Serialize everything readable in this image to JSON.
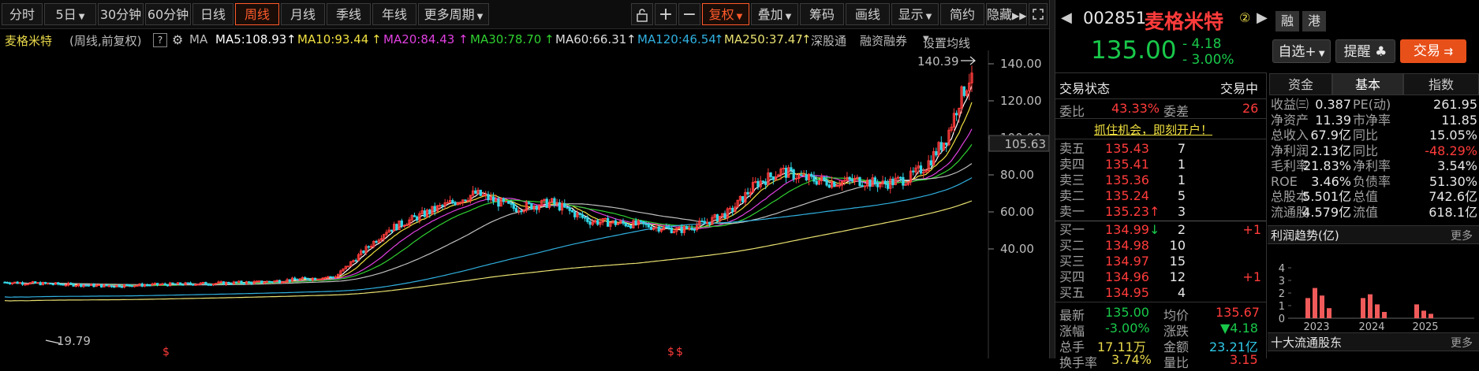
{
  "toolbar": {
    "tabs": [
      "分时",
      "5日",
      "30分钟",
      "60分钟",
      "日线",
      "周线",
      "月线",
      "季线",
      "年线",
      "更多周期"
    ],
    "active_tab": "周线",
    "tools": [
      "复权",
      "叠加",
      "筹码",
      "画线",
      "显示",
      "简约",
      "隐藏"
    ],
    "tools_active": "复权"
  },
  "ma_line": {
    "stock_name": "麦格米特",
    "mode": "(周线,前复权)",
    "help": "?",
    "ma_label": "MA",
    "ma5": "MA5:108.93",
    "ma10": "MA10:93.44",
    "ma20": "MA20:84.43",
    "ma30": "MA30:78.70",
    "ma60": "MA60:66.31",
    "ma120": "MA120:46.54",
    "ma250": "MA250:37.47",
    "link1": "深股通",
    "link2": "融资融券",
    "link3": "设置均线"
  },
  "chart_data": {
    "type": "candlestick",
    "yticks": [
      "140.00",
      "120.00",
      "100.00",
      "80.00",
      "60.00",
      "40.00"
    ],
    "ylim": [
      28,
      148
    ],
    "current_price_tag": "105.63",
    "high_label": "140.39",
    "low_label": "19.79",
    "markers": [
      "$",
      "$",
      "$"
    ],
    "ma_colors": {
      "ma5": "#ffffff",
      "ma10": "#f0e040",
      "ma20": "#e040e0",
      "ma30": "#30d030",
      "ma60": "#c0c0c0",
      "ma120": "#30b0e0",
      "ma250": "#e8e070"
    }
  },
  "quote": {
    "code": "002851",
    "name": "麦格米特",
    "badge": "②",
    "tag1": "融",
    "tag2": "港",
    "price": "135.00",
    "change": "- 4.18",
    "change_pct": "- 3.00%",
    "btn_watch": "自选+",
    "btn_alert": "提醒",
    "btn_trade": "交易"
  },
  "order_book": {
    "status_label": "交易状态",
    "status_value": "交易中",
    "webi_label": "委比",
    "webi_value": "43.33%",
    "weicha_label": "委差",
    "weicha_value": "26",
    "banner": "抓住机会，即刻开户！",
    "sells": [
      {
        "label": "卖五",
        "price": "135.43",
        "vol": "7",
        "mark": ""
      },
      {
        "label": "卖四",
        "price": "135.41",
        "vol": "1",
        "mark": ""
      },
      {
        "label": "卖三",
        "price": "135.36",
        "vol": "1",
        "mark": ""
      },
      {
        "label": "卖二",
        "price": "135.24",
        "vol": "5",
        "mark": ""
      },
      {
        "label": "卖一",
        "price": "135.23",
        "vol": "3",
        "mark": "↑"
      }
    ],
    "buys": [
      {
        "label": "买一",
        "price": "134.99",
        "vol": "2",
        "mark": "↓",
        "delta": "+1"
      },
      {
        "label": "买二",
        "price": "134.98",
        "vol": "10",
        "mark": "",
        "delta": ""
      },
      {
        "label": "买三",
        "price": "134.97",
        "vol": "15",
        "mark": "",
        "delta": ""
      },
      {
        "label": "买四",
        "price": "134.96",
        "vol": "12",
        "mark": "",
        "delta": "+1"
      },
      {
        "label": "买五",
        "price": "134.95",
        "vol": "4",
        "mark": "",
        "delta": ""
      }
    ]
  },
  "stats": {
    "latest_label": "最新",
    "latest": "135.00",
    "avg_label": "均价",
    "avg": "135.67",
    "pct_label": "涨幅",
    "pct": "-3.00%",
    "chg_label": "涨跌",
    "chg": "▼4.18",
    "vol_label": "总手",
    "vol": "17.11万",
    "amt_label": "金额",
    "amt": "23.21亿",
    "turnover_label": "换手率",
    "turnover": "3.74%",
    "ratio_label": "量比",
    "ratio": "3.15"
  },
  "fin_tabs": [
    "资金",
    "基本",
    "指数"
  ],
  "fin_active": "基本",
  "fin": [
    [
      "收益㈢",
      "0.387",
      "PE(动)",
      "261.95"
    ],
    [
      "净资产",
      "11.39",
      "市净率",
      "11.85"
    ],
    [
      "总收入",
      "67.9亿",
      "同比",
      "15.05%"
    ],
    [
      "净利润",
      "2.13亿",
      "同比",
      "-48.29%"
    ],
    [
      "毛利率",
      "21.83%",
      "净利率",
      "3.54%"
    ],
    [
      "ROE",
      "3.46%",
      "负债率",
      "51.30%"
    ],
    [
      "总股本",
      "5.501亿",
      "总值",
      "742.6亿"
    ],
    [
      "流通股",
      "4.579亿",
      "流值",
      "618.1亿"
    ]
  ],
  "profit": {
    "title": "利润趋势(亿)",
    "more": "更多",
    "yticks": [
      "4",
      "3",
      "2",
      "1",
      "0"
    ],
    "years": [
      "2023",
      "2024",
      "2025"
    ],
    "values": [
      1.6,
      2.4,
      1.8,
      0.8,
      1.6,
      1.9,
      1.1,
      0.5,
      1.1,
      0.6,
      0.35
    ]
  },
  "holders": {
    "title": "十大流通股东",
    "more": "更多"
  }
}
